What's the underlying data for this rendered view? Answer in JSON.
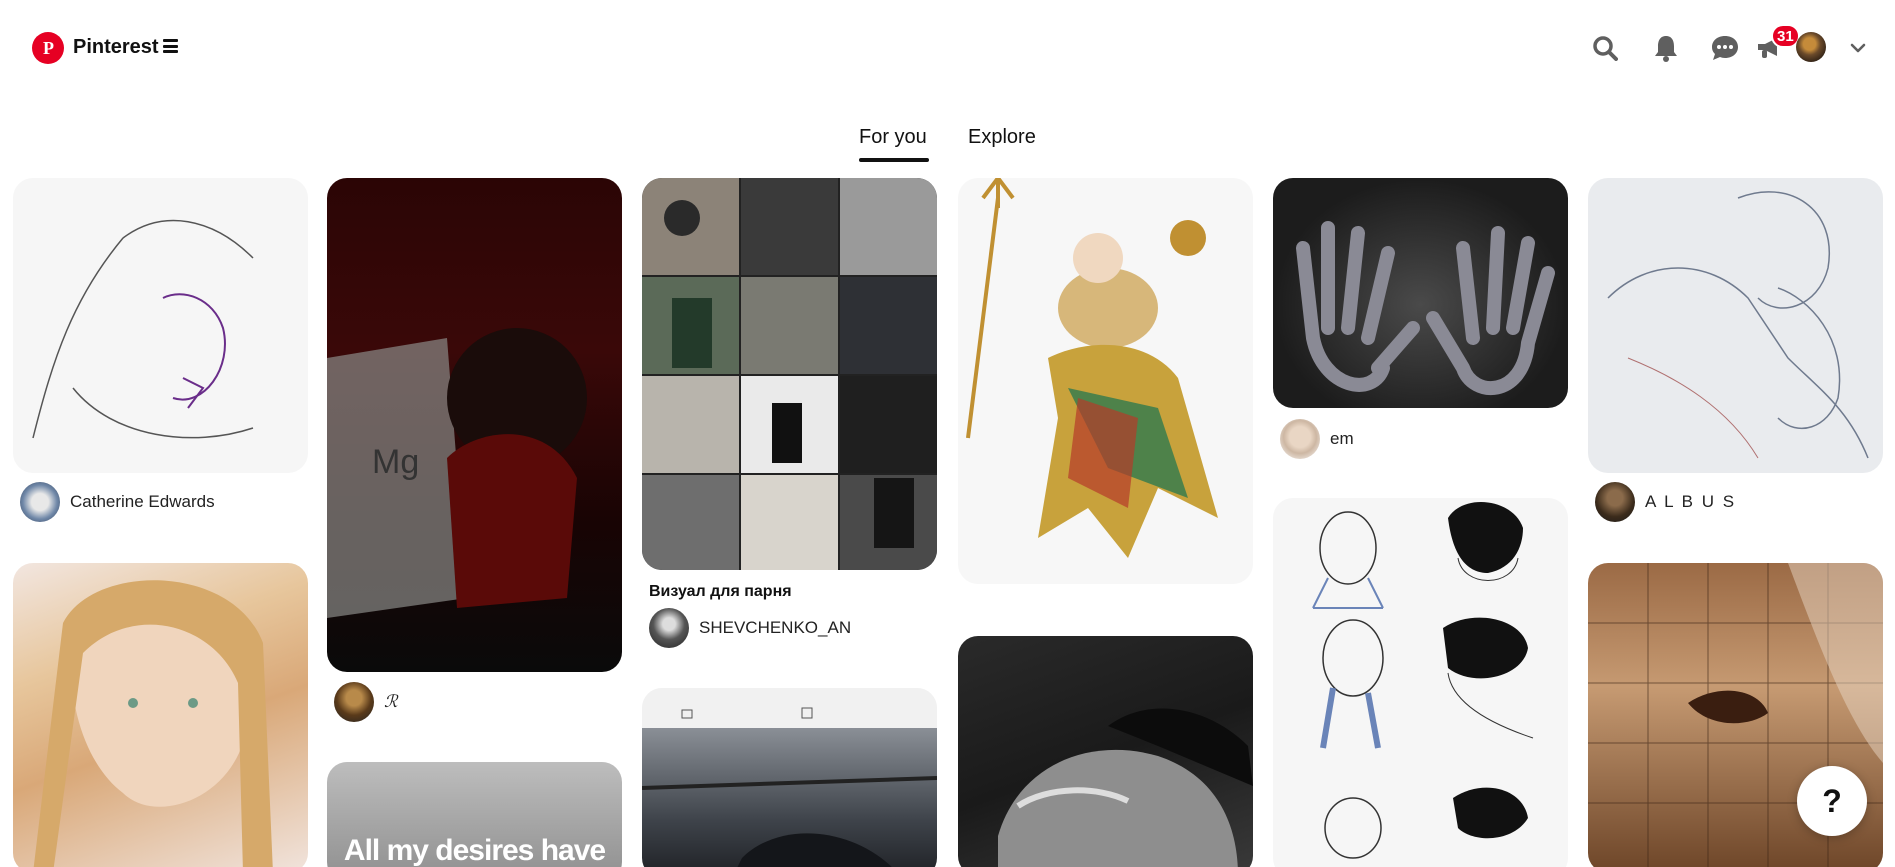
{
  "header": {
    "brand": "Pinterest",
    "notification_count": "31",
    "icons": [
      "pinterest-logo-icon",
      "menu-icon",
      "search-icon",
      "bell-icon",
      "chat-icon",
      "megaphone-icon",
      "avatar",
      "chevron-down-icon"
    ]
  },
  "tabs": [
    {
      "label": "For you",
      "active": true
    },
    {
      "label": "Explore",
      "active": false
    }
  ],
  "pins": {
    "p1": {
      "author": "Catherine Edwards"
    },
    "p2": {
      "author": "ℛ"
    },
    "p3": {
      "title": "Визуал для парня",
      "author": "SHEVCHENKO_AN"
    },
    "p4": {},
    "p5": {
      "author": "em"
    },
    "p6": {
      "author": "A L B U S"
    },
    "p7": {
      "overlay_text": "All my desires have"
    }
  },
  "help": {
    "label": "?"
  },
  "colors": {
    "brand": "#e60023",
    "text": "#111111"
  }
}
